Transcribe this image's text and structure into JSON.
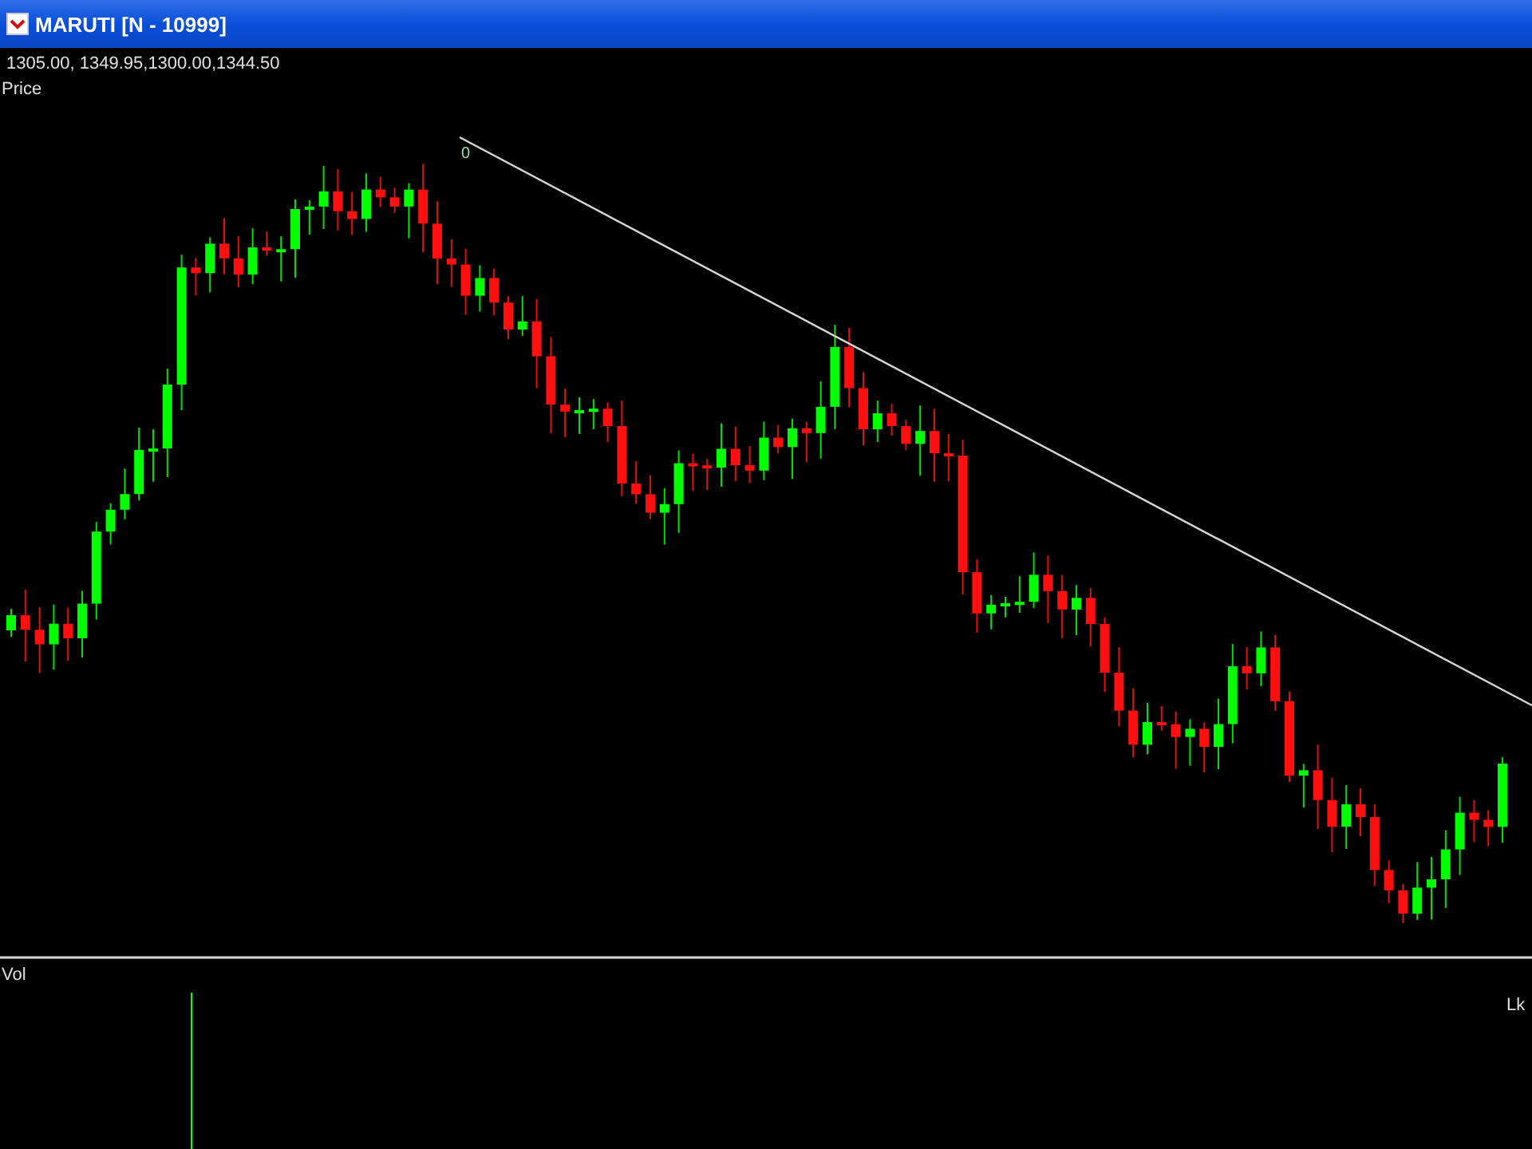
{
  "window": {
    "title": "MARUTI [N - 10999]"
  },
  "price_pane": {
    "ohlc": "1305.00,  1349.95,1300.00,1344.50",
    "label": "Price",
    "trendline_label": "0"
  },
  "volume_pane": {
    "label": "Vol",
    "unit": "Lk"
  }
}
